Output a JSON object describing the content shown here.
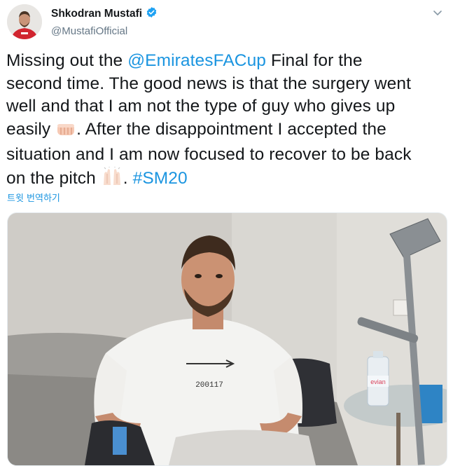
{
  "author": {
    "display_name": "Shkodran Mustafi",
    "handle": "@MustafiOfficial",
    "verified": true
  },
  "tweet": {
    "line1_prefix": "Missing out the ",
    "line1_mention": "@EmiratesFACup",
    "line1_suffix": " Final for the",
    "line2": "second time. The good news is that the surgery went",
    "line3": "well and that I am not the type of guy who gives up",
    "line4_prefix": "easily ",
    "line4_suffix": ". After the disappointment I accepted the",
    "line5": "situation and I am now focused to recover to be back",
    "line6_prefix": "on the pitch ",
    "line6_mid": ". ",
    "line6_hashtag": "#SM20"
  },
  "translate_label": "트윗 번역하기",
  "media": {
    "shirt_text": "200117",
    "bottle_label": "evian"
  },
  "icons": {
    "verified": "verified-badge-icon",
    "more": "chevron-down-icon",
    "emoji_fist": "fist-emoji",
    "emoji_hands": "raised-hands-emoji"
  },
  "colors": {
    "link": "#1b95e0",
    "text": "#14171a",
    "secondary": "#657786"
  }
}
